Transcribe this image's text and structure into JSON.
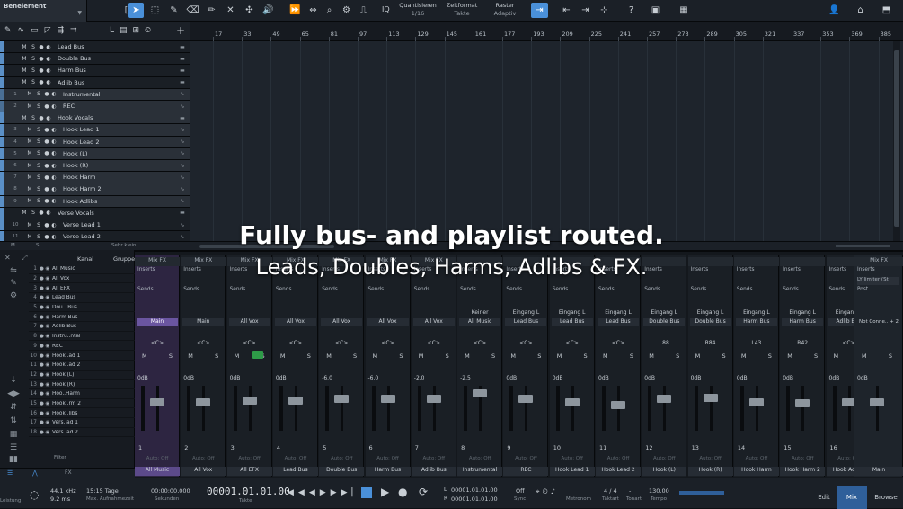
{
  "toolbar": {
    "selection_label": "Benelement",
    "quantize_label": "Quantisieren",
    "quantize_value": "1/16",
    "timebase_label": "Zeitformat",
    "timebase_value": "Takte",
    "snap_label": "Raster",
    "snap_value": "Adaptiv",
    "iq_label": "IQ"
  },
  "ruler": {
    "marks": [
      "17",
      "33",
      "49",
      "65",
      "81",
      "97",
      "113",
      "129",
      "145",
      "161",
      "177",
      "193",
      "209",
      "225",
      "241",
      "257",
      "273",
      "289",
      "305",
      "321",
      "337",
      "353",
      "369",
      "385"
    ]
  },
  "tracks": [
    {
      "num": "",
      "name": "Lead Bus",
      "color": "#5a8fc6",
      "type": "folder",
      "sel": false
    },
    {
      "num": "",
      "name": "Double Bus",
      "color": "#5a8fc6",
      "type": "folder",
      "sel": false
    },
    {
      "num": "",
      "name": "Harm Bus",
      "color": "#5a8fc6",
      "type": "folder",
      "sel": false
    },
    {
      "num": "",
      "name": "Adlib Bus",
      "color": "#5a8fc6",
      "type": "folder",
      "sel": false
    },
    {
      "num": "1",
      "name": "Instrumental",
      "color": "#4a6f95",
      "type": "audio",
      "sel": true
    },
    {
      "num": "2",
      "name": "REC",
      "color": "#4a6f95",
      "type": "audio",
      "sel": true
    },
    {
      "num": "",
      "name": "Hook Vocals",
      "color": "#5a8fc6",
      "type": "folder",
      "sel": true
    },
    {
      "num": "3",
      "name": "Hook Lead 1",
      "color": "#5a8fc6",
      "type": "audio",
      "sel": true
    },
    {
      "num": "4",
      "name": "Hook Lead 2",
      "color": "#5a8fc6",
      "type": "audio",
      "sel": true
    },
    {
      "num": "5",
      "name": "Hook (L)",
      "color": "#5a8fc6",
      "type": "audio",
      "sel": true
    },
    {
      "num": "6",
      "name": "Hook (R)",
      "color": "#5a8fc6",
      "type": "audio",
      "sel": true
    },
    {
      "num": "7",
      "name": "Hook Harm",
      "color": "#5a8fc6",
      "type": "audio",
      "sel": true
    },
    {
      "num": "8",
      "name": "Hook Harm 2",
      "color": "#5a8fc6",
      "type": "audio",
      "sel": true
    },
    {
      "num": "9",
      "name": "Hook Adlibs",
      "color": "#5a8fc6",
      "type": "audio",
      "sel": true
    },
    {
      "num": "",
      "name": "Verse Vocals",
      "color": "#5a8fc6",
      "type": "folder",
      "sel": false
    },
    {
      "num": "10",
      "name": "Verse Lead 1",
      "color": "#5a8fc6",
      "type": "audio",
      "sel": false
    },
    {
      "num": "11",
      "name": "Verse Lead 2",
      "color": "#5a8fc6",
      "type": "audio",
      "sel": false
    }
  ],
  "arrange_footer": {
    "m": "M",
    "s": "S",
    "label": "Sehr klein"
  },
  "overlay": {
    "line1": "Fully bus- and playlist routed.",
    "line2": "Leads, Doubles, Harms, Adlibs & FX."
  },
  "mixer_left": {
    "header_kanal": "Kanal",
    "header_gruppe": "Gruppe",
    "filter_label": "Filter",
    "rows": [
      {
        "n": "1",
        "t": "All Music"
      },
      {
        "n": "2",
        "t": "All Vox"
      },
      {
        "n": "3",
        "t": "All EFX"
      },
      {
        "n": "4",
        "t": "Lead Bus"
      },
      {
        "n": "5",
        "t": "Dou.. Bus"
      },
      {
        "n": "6",
        "t": "Harm Bus"
      },
      {
        "n": "7",
        "t": "Adlib Bus"
      },
      {
        "n": "8",
        "t": "Instru..ntal"
      },
      {
        "n": "9",
        "t": "REC"
      },
      {
        "n": "10",
        "t": "Hook..ad 1"
      },
      {
        "n": "11",
        "t": "Hook..ad 2"
      },
      {
        "n": "12",
        "t": "Hook (L)"
      },
      {
        "n": "13",
        "t": "Hook (R)"
      },
      {
        "n": "14",
        "t": "Hoo..Harm"
      },
      {
        "n": "15",
        "t": "Hook..rm 2"
      },
      {
        "n": "16",
        "t": "Hook..libs"
      },
      {
        "n": "17",
        "t": "Vers..ad 1"
      },
      {
        "n": "18",
        "t": "Vers..ad 2"
      }
    ]
  },
  "strips": [
    {
      "fx": "Mix FX",
      "inp": "",
      "outp": "Main",
      "pan": "<C>",
      "db": "0dB",
      "num": "1",
      "auto": "Auto: Off",
      "name": "All Music",
      "purple": true
    },
    {
      "fx": "Mix FX",
      "inp": "",
      "outp": "Main",
      "pan": "<C>",
      "db": "0dB",
      "num": "2",
      "auto": "Auto: Off",
      "name": "All Vox",
      "purple": false
    },
    {
      "fx": "Mix FX",
      "inp": "",
      "outp": "All Vox",
      "pan": "<C>",
      "db": "0dB",
      "num": "3",
      "auto": "Auto: Off",
      "name": "All EFX",
      "purple": false
    },
    {
      "fx": "Mix FX",
      "inp": "",
      "outp": "All Vox",
      "pan": "<C>",
      "db": "0dB",
      "num": "4",
      "auto": "Auto: Off",
      "name": "Lead Bus",
      "purple": false
    },
    {
      "fx": "Mix FX",
      "inp": "",
      "outp": "All Vox",
      "pan": "<C>",
      "db": "-6.0",
      "num": "5",
      "auto": "Auto: Off",
      "name": "Double Bus",
      "purple": false
    },
    {
      "fx": "Mix FX",
      "inp": "",
      "outp": "All Vox",
      "pan": "<C>",
      "db": "-6.0",
      "num": "6",
      "auto": "Auto: Off",
      "name": "Harm Bus",
      "purple": false
    },
    {
      "fx": "Mix FX",
      "inp": "",
      "outp": "All Vox",
      "pan": "<C>",
      "db": "-2.0",
      "num": "7",
      "auto": "Auto: Off",
      "name": "Adlib Bus",
      "purple": false
    },
    {
      "fx": "",
      "inp": "Keiner",
      "outp": "All Music",
      "pan": "<C>",
      "db": "-2.5",
      "num": "8",
      "auto": "Auto: Off",
      "name": "Instrumental",
      "purple": false
    },
    {
      "fx": "",
      "inp": "Eingang L",
      "outp": "Lead Bus",
      "pan": "<C>",
      "db": "0dB",
      "num": "9",
      "auto": "Auto: Off",
      "name": "REC",
      "purple": false
    },
    {
      "fx": "",
      "inp": "Eingang L",
      "outp": "Lead Bus",
      "pan": "<C>",
      "db": "0dB",
      "num": "10",
      "auto": "Auto: Off",
      "name": "Hook Lead 1",
      "purple": false
    },
    {
      "fx": "",
      "inp": "Eingang L",
      "outp": "Lead Bus",
      "pan": "<C>",
      "db": "0dB",
      "num": "11",
      "auto": "Auto: Off",
      "name": "Hook Lead 2",
      "purple": false
    },
    {
      "fx": "",
      "inp": "Eingang L",
      "outp": "Double Bus",
      "pan": "L88",
      "db": "0dB",
      "num": "12",
      "auto": "Auto: Off",
      "name": "Hook (L)",
      "purple": false
    },
    {
      "fx": "",
      "inp": "Eingang L",
      "outp": "Double Bus",
      "pan": "R84",
      "db": "0dB",
      "num": "13",
      "auto": "Auto: Off",
      "name": "Hook (R)",
      "purple": false
    },
    {
      "fx": "",
      "inp": "Eingang L",
      "outp": "Harm Bus",
      "pan": "L43",
      "db": "0dB",
      "num": "14",
      "auto": "Auto: Off",
      "name": "Hook Harm",
      "purple": false
    },
    {
      "fx": "",
      "inp": "Eingang L",
      "outp": "Harm Bus",
      "pan": "R42",
      "db": "0dB",
      "num": "15",
      "auto": "Auto: Off",
      "name": "Hook Harm 2",
      "purple": false
    },
    {
      "fx": "",
      "inp": "Eingang L",
      "outp": "Adlib Bus",
      "pan": "<C>",
      "db": "0dB",
      "num": "16",
      "auto": "Auto: Off",
      "name": "Hook Adlibs",
      "purple": false
    }
  ],
  "master_strip": {
    "fx": "Mix FX",
    "inserts": "Inserts",
    "insert1": "LY limiter (St",
    "post": "Post",
    "outp": "Not Conne.. + 2",
    "db": "0dB",
    "name": "Main"
  },
  "labels": {
    "inserts": "Inserts",
    "sends": "Sends",
    "m": "M",
    "s": "S"
  },
  "transport": {
    "leistung": "Leistung",
    "sample_rate": "44.1 kHz",
    "latency": "9.2 ms",
    "record_days": "15:15 Tage",
    "record_label": "Max. Aufnahmezeit",
    "seconds": "00:00:00.000",
    "seconds_label": "Sekunden",
    "position": "00001.01.01.00",
    "position_label": "Takte",
    "loop_start": "00001.01.01.00",
    "loop_end": "00001.01.01.00",
    "sync": "Off",
    "sync_label": "Sync",
    "metronome_label": "Metronom",
    "timesig": "4 / 4",
    "timesig_label": "Taktart",
    "key_label": "Tonart",
    "tempo": "130.00",
    "tempo_label": "Tempo",
    "tab_edit": "Edit",
    "tab_mix": "Mix",
    "tab_browse": "Browse"
  },
  "colors": {
    "accent": "#4a90d9",
    "selected_strip": "#5c4a8a",
    "record_green": "#2e9b48"
  }
}
